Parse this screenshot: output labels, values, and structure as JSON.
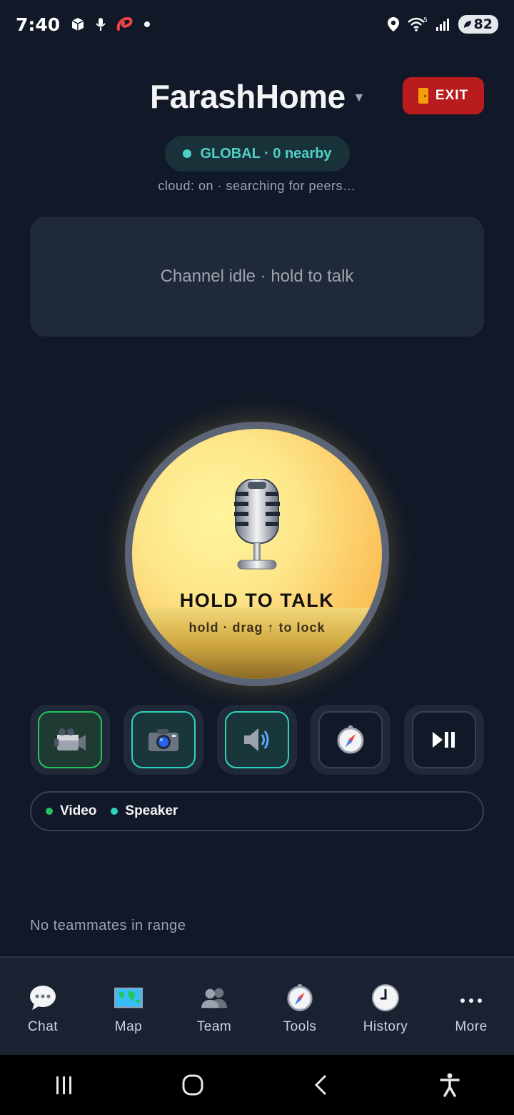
{
  "status_bar": {
    "time": "7:40",
    "battery": "82",
    "wifi_badge": "5",
    "icons": [
      "box-icon",
      "mic-icon",
      "airtel-icon",
      "dot-icon",
      "location-icon",
      "wifi-icon",
      "signal-icon",
      "battery-icon"
    ]
  },
  "header": {
    "title": "FarashHome",
    "caret": "▼",
    "exit_label": "EXIT"
  },
  "channel": {
    "pill_label": "GLOBAL · 0 nearby",
    "cloud_status": "cloud: on · searching for peers…"
  },
  "idle_card": {
    "text": "Channel idle · hold to talk"
  },
  "ptt": {
    "label": "HOLD TO TALK",
    "sublabel": "hold · drag ↑ to lock"
  },
  "tools": [
    {
      "name": "video-camera-button",
      "icon": "video-camera-icon",
      "state": "active-green"
    },
    {
      "name": "camera-button",
      "icon": "camera-icon",
      "state": "active-teal"
    },
    {
      "name": "speaker-button",
      "icon": "speaker-icon",
      "state": "active-teal"
    },
    {
      "name": "compass-button",
      "icon": "compass-icon",
      "state": "inactive"
    },
    {
      "name": "play-pause-button",
      "icon": "play-pause-icon",
      "state": "inactive"
    }
  ],
  "legend": {
    "items": [
      {
        "label": "Video",
        "color": "#22c55e"
      },
      {
        "label": "Speaker",
        "color": "#2dd4bf"
      }
    ]
  },
  "team_status": "No teammates in range",
  "tabs": [
    {
      "label": "Chat",
      "icon": "chat-bubble-icon"
    },
    {
      "label": "Map",
      "icon": "map-icon"
    },
    {
      "label": "Team",
      "icon": "team-icon"
    },
    {
      "label": "Tools",
      "icon": "compass-icon"
    },
    {
      "label": "History",
      "icon": "clock-icon"
    },
    {
      "label": "More",
      "icon": "more-dots-icon"
    }
  ],
  "colors": {
    "background": "#111827",
    "accent_teal": "#4fd1c5",
    "exit_red": "#b91c1c"
  }
}
